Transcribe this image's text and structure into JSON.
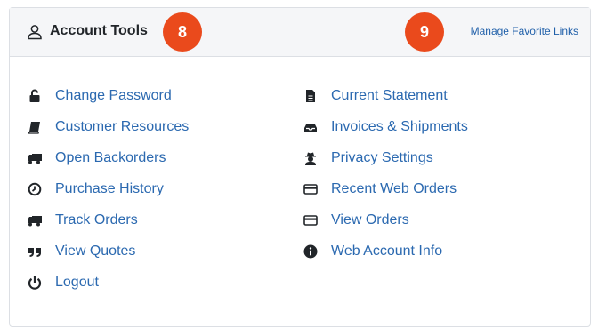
{
  "header": {
    "title": "Account Tools",
    "title_icon": "user-icon",
    "manage_link": "Manage Favorite Links",
    "badges": [
      "8",
      "9"
    ]
  },
  "left_links": [
    {
      "label": "Change Password",
      "icon": "lock-open-icon"
    },
    {
      "label": "Customer Resources",
      "icon": "book-icon"
    },
    {
      "label": "Open Backorders",
      "icon": "truck-icon"
    },
    {
      "label": "Purchase History",
      "icon": "clock-icon"
    },
    {
      "label": "Track Orders",
      "icon": "truck-icon"
    },
    {
      "label": "View Quotes",
      "icon": "quote-icon"
    },
    {
      "label": "Logout",
      "icon": "power-icon"
    }
  ],
  "right_links": [
    {
      "label": "Current Statement",
      "icon": "file-icon"
    },
    {
      "label": "Invoices & Shipments",
      "icon": "inbox-icon"
    },
    {
      "label": "Privacy Settings",
      "icon": "user-secret-icon"
    },
    {
      "label": "Recent Web Orders",
      "icon": "credit-card-icon"
    },
    {
      "label": "View Orders",
      "icon": "credit-card-icon"
    },
    {
      "label": "Web Account Info",
      "icon": "info-circle-icon"
    }
  ],
  "colors": {
    "link": "#2b69b0",
    "badge": "#ea4a1c",
    "header_bg": "#f5f6f8"
  }
}
